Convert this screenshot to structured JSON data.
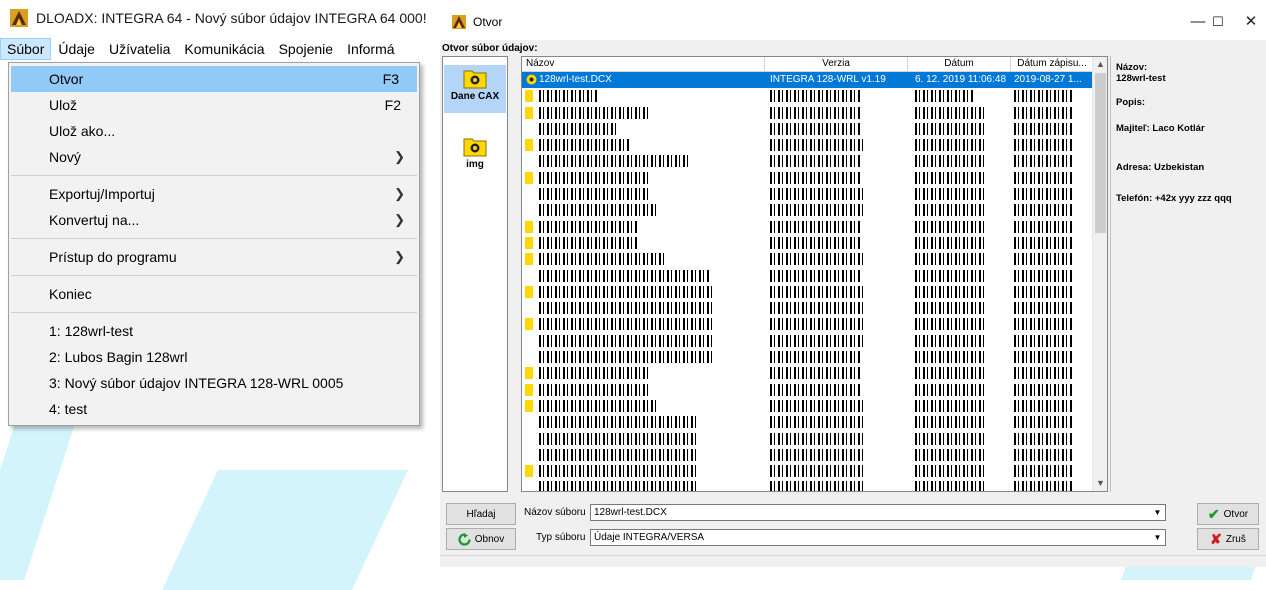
{
  "left_window": {
    "title": "DLOADX: INTEGRA 64 - Nový súbor údajov INTEGRA 64 000!",
    "menubar": [
      "Súbor",
      "Údaje",
      "Užívatelia",
      "Komunikácia",
      "Spojenie",
      "Informá"
    ],
    "dropdown": {
      "open": "Otvor",
      "open_shortcut": "F3",
      "save": "Ulož",
      "save_shortcut": "F2",
      "save_as": "Ulož ako...",
      "new": "Nový",
      "export_import": "Exportuj/Importuj",
      "convert": "Konvertuj na...",
      "access": "Prístup do programu",
      "exit": "Koniec",
      "recent": [
        "1: 128wrl-test",
        "2: Lubos Bagin 128wrl",
        "3: Nový súbor údajov INTEGRA 128-WRL 0005",
        "4: test"
      ]
    }
  },
  "dialog": {
    "title": "Otvor",
    "header": "Otvor súbor údajov:",
    "folders": [
      "Dane CAX",
      "img"
    ],
    "columns": [
      "Názov",
      "Verzia",
      "Dátum",
      "Dátum zápisu..."
    ],
    "selected_row": {
      "name": "128wrl-test.DCX",
      "version": "INTEGRA 128-WRL v1.19",
      "date": "6. 12. 2019 11:06:48",
      "write_date": "2019-08-27 1..."
    },
    "info": {
      "name_label": "Názov:",
      "name_value": "128wrl-test",
      "desc_label": "Popis:",
      "owner": "Majiteľ: Laco Kotlár",
      "address": "Adresa: Uzbekistan",
      "phone": "Telefón: +42x yyy zzz qqq"
    },
    "search_button": "Hľadaj",
    "refresh_button": "Obnov",
    "filename_label": "Názov súboru",
    "filename_value": "128wrl-test.DCX",
    "filetype_label": "Typ súboru",
    "filetype_value": "Údaje INTEGRA/VERSA",
    "open_button": "Otvor",
    "cancel_button": "Zruš"
  },
  "colors": {
    "selection": "#0078d7",
    "menu_highlight": "#91c9f7",
    "watermark": "#d4f4fb",
    "folder": "#ffd800"
  }
}
